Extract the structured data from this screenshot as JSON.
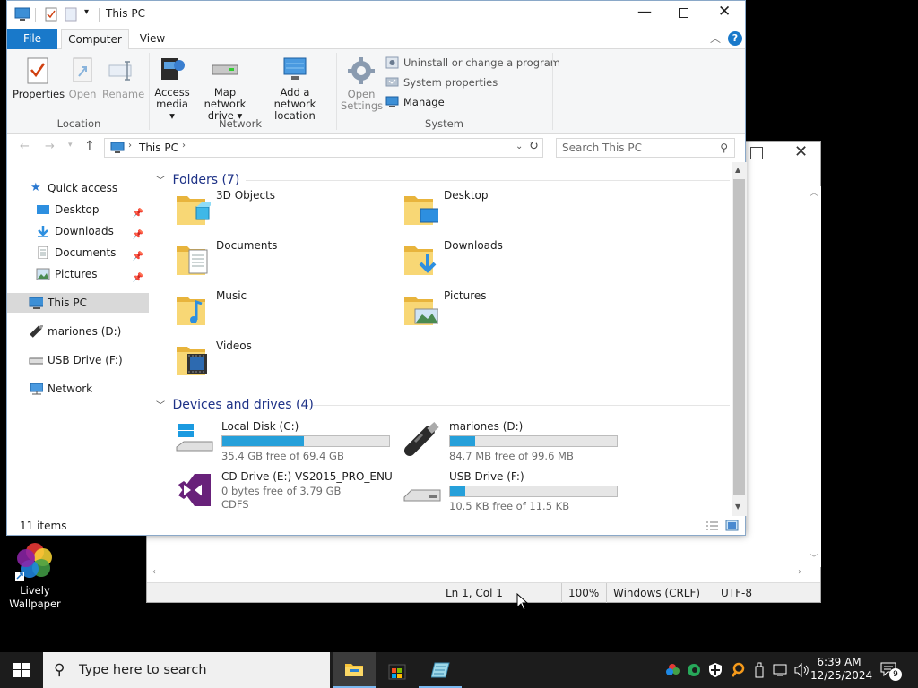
{
  "desktop": {
    "icon_label": "Lively\nWallpaper",
    "icon_line1": "Lively",
    "icon_line2": "Wallpaper"
  },
  "notepad": {
    "status": {
      "position": "Ln 1, Col 1",
      "zoom": "100%",
      "line_ending": "Windows (CRLF)",
      "encoding": "UTF-8"
    }
  },
  "explorer": {
    "title": "This PC",
    "tabs": {
      "file": "File",
      "computer": "Computer",
      "view": "View"
    },
    "ribbon": {
      "location": {
        "group": "Location",
        "properties": "Properties",
        "open": "Open",
        "rename": "Rename"
      },
      "network": {
        "group": "Network",
        "access_media_1": "Access",
        "access_media_2": "media",
        "map_drive_1": "Map network",
        "map_drive_2": "drive",
        "add_location_1": "Add a network",
        "add_location_2": "location"
      },
      "system": {
        "group": "System",
        "open_settings_1": "Open",
        "open_settings_2": "Settings",
        "uninstall": "Uninstall or change a program",
        "sys_props": "System properties",
        "manage": "Manage"
      }
    },
    "address": {
      "crumb": "This PC",
      "search_placeholder": "Search This PC"
    },
    "nav": {
      "quick_access": "Quick access",
      "desktop": "Desktop",
      "downloads": "Downloads",
      "documents": "Documents",
      "pictures": "Pictures",
      "this_pc": "This PC",
      "mariones": "mariones (D:)",
      "usb": "USB Drive (F:)",
      "network": "Network"
    },
    "folders_header": "Folders (7)",
    "folders": [
      "3D Objects",
      "Desktop",
      "Documents",
      "Downloads",
      "Music",
      "Pictures",
      "Videos"
    ],
    "drives_header": "Devices and drives (4)",
    "drives": [
      {
        "name": "Local Disk (C:)",
        "free": "35.4 GB free of 69.4 GB",
        "used_fraction": 0.49
      },
      {
        "name": "mariones (D:)",
        "free": "84.7 MB free of 99.6 MB",
        "used_fraction": 0.15
      },
      {
        "name": "CD Drive (E:) VS2015_PRO_ENU",
        "free": "0 bytes free of 3.79 GB",
        "fs": "CDFS"
      },
      {
        "name": "USB Drive (F:)",
        "free": "10.5 KB free of 11.5 KB",
        "used_fraction": 0.09
      }
    ],
    "status": {
      "items": "11 items"
    }
  },
  "taskbar": {
    "search_placeholder": "Type here to search",
    "time": "6:39 AM",
    "date": "12/25/2024",
    "notifications": "9"
  },
  "colors": {
    "accent": "#1a73c8",
    "drive_bar": "#26a0da",
    "folder": "#f8d775",
    "taskbar": "#1c1c1c"
  }
}
